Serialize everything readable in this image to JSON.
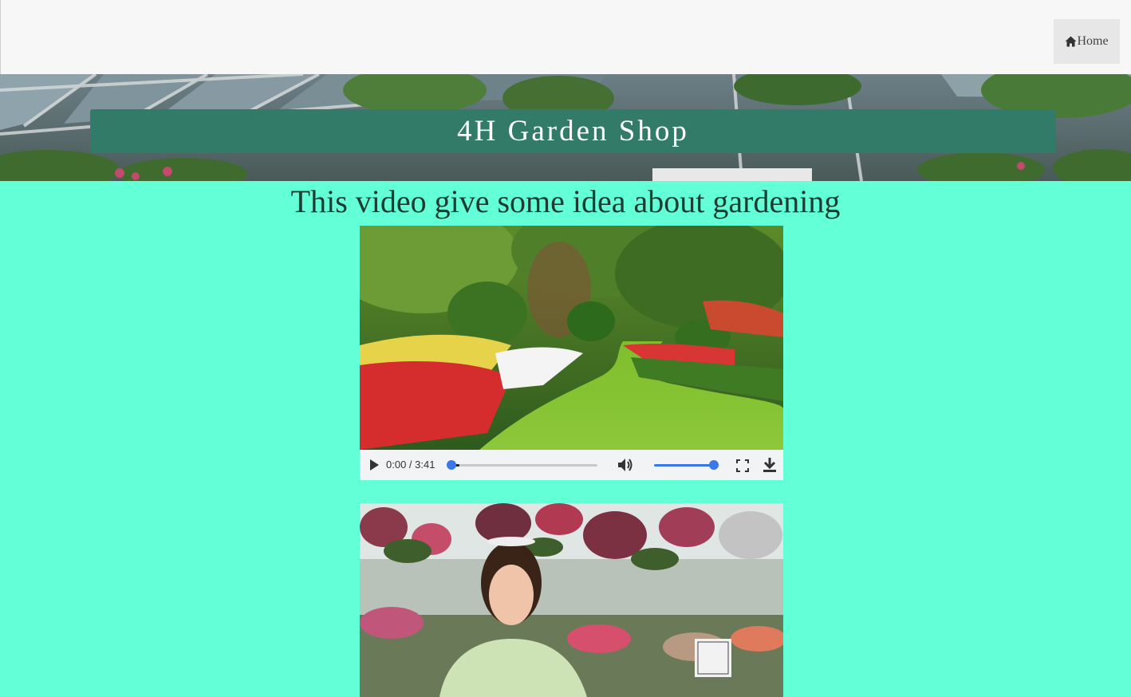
{
  "nav": {
    "home_label": "Home"
  },
  "header": {
    "title": "4H Garden Shop"
  },
  "main": {
    "intro": "This video give some idea about gardening",
    "videos": [
      {
        "time_display": "0:00 / 3:41",
        "progress": 0.0,
        "volume": 1.0
      }
    ]
  },
  "colors": {
    "page_bg": "#63ffd6",
    "title_bar": "#337b69",
    "accent": "#3b78e7"
  }
}
